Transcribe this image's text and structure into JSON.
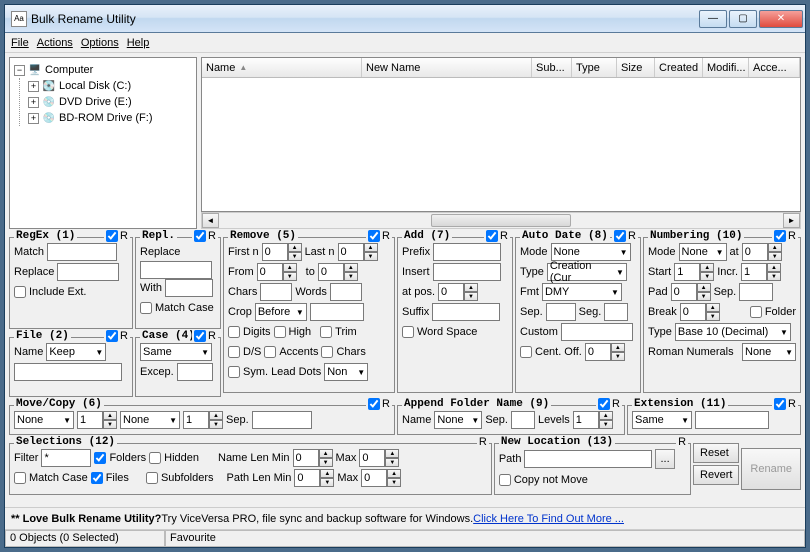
{
  "window": {
    "title": "Bulk Rename Utility"
  },
  "menu": {
    "file": "File",
    "actions": "Actions",
    "options": "Options",
    "help": "Help"
  },
  "tree": {
    "root": "Computer",
    "items": [
      {
        "label": "Local Disk (C:)"
      },
      {
        "label": "DVD Drive (E:)"
      },
      {
        "label": "BD-ROM Drive (F:)"
      }
    ]
  },
  "columns": {
    "name": "Name",
    "newname": "New Name",
    "sub": "Sub...",
    "type": "Type",
    "size": "Size",
    "created": "Created",
    "modified": "Modifi...",
    "accessed": "Acce..."
  },
  "regex": {
    "title": "RegEx (1)",
    "match": "Match",
    "replace": "Replace",
    "include_ext": "Include Ext.",
    "r": "R"
  },
  "repl": {
    "title": "Repl.",
    "replace": "Replace",
    "with": "With",
    "match_case": "Match Case",
    "r": "R"
  },
  "file": {
    "title": "File (2)",
    "name": "Name",
    "name_val": "Keep",
    "r": "R"
  },
  "case": {
    "title": "Case (4)",
    "val": "Same",
    "excep": "Excep.",
    "r": "R"
  },
  "remove": {
    "title": "Remove (5)",
    "firstn": "First n",
    "lastn": "Last n",
    "from": "From",
    "to": "to",
    "chars": "Chars",
    "words": "Words",
    "crop": "Crop",
    "crop_val": "Before",
    "digits": "Digits",
    "high": "High",
    "trim": "Trim",
    "ds": "D/S",
    "accents": "Accents",
    "chars2": "Chars",
    "sym": "Sym.",
    "leaddots": "Lead Dots",
    "leaddots_val": "Non",
    "r": "R",
    "v0": "0"
  },
  "add": {
    "title": "Add (7)",
    "prefix": "Prefix",
    "insert": "Insert",
    "atpos": "at pos.",
    "suffix": "Suffix",
    "wordspace": "Word Space",
    "r": "R",
    "v0": "0"
  },
  "autodate": {
    "title": "Auto Date (8)",
    "mode": "Mode",
    "mode_val": "None",
    "type": "Type",
    "type_val": "Creation (Cur",
    "fmt": "Fmt",
    "fmt_val": "DMY",
    "sep": "Sep.",
    "seg": "Seg.",
    "custom": "Custom",
    "cent": "Cent.",
    "off": "Off.",
    "r": "R",
    "v0": "0"
  },
  "numbering": {
    "title": "Numbering (10)",
    "mode": "Mode",
    "mode_val": "None",
    "at": "at",
    "start": "Start",
    "incr": "Incr.",
    "pad": "Pad",
    "sep": "Sep.",
    "break": "Break",
    "folder": "Folder",
    "type": "Type",
    "type_val": "Base 10 (Decimal)",
    "roman": "Roman Numerals",
    "roman_val": "None",
    "r": "R",
    "v0": "0",
    "v1": "1"
  },
  "movecopy": {
    "title": "Move/Copy (6)",
    "none": "None",
    "sep": "Sep.",
    "r": "R",
    "v1": "1"
  },
  "appendfolder": {
    "title": "Append Folder Name (9)",
    "name": "Name",
    "name_val": "None",
    "sep": "Sep.",
    "levels": "Levels",
    "r": "R",
    "v1": "1"
  },
  "extension": {
    "title": "Extension (11)",
    "val": "Same",
    "r": "R"
  },
  "selections": {
    "title": "Selections (12)",
    "filter": "Filter",
    "filter_val": "*",
    "folders": "Folders",
    "hidden": "Hidden",
    "namelenmin": "Name Len Min",
    "max": "Max",
    "matchcase": "Match Case",
    "files": "Files",
    "subfolders": "Subfolders",
    "pathlenmin": "Path Len Min",
    "r": "R",
    "v0": "0"
  },
  "newlocation": {
    "title": "New Location (13)",
    "path": "Path",
    "copynotmove": "Copy not Move",
    "browse": "...",
    "r": "R"
  },
  "buttons": {
    "reset": "Reset",
    "revert": "Revert",
    "rename": "Rename"
  },
  "footer": {
    "love": "** Love Bulk Rename Utility?",
    "try": " Try ViceVersa PRO, file sync and backup software for Windows. ",
    "link": "Click Here To Find Out More ..."
  },
  "status": {
    "objects": "0 Objects (0 Selected)",
    "fav": "Favourite"
  }
}
